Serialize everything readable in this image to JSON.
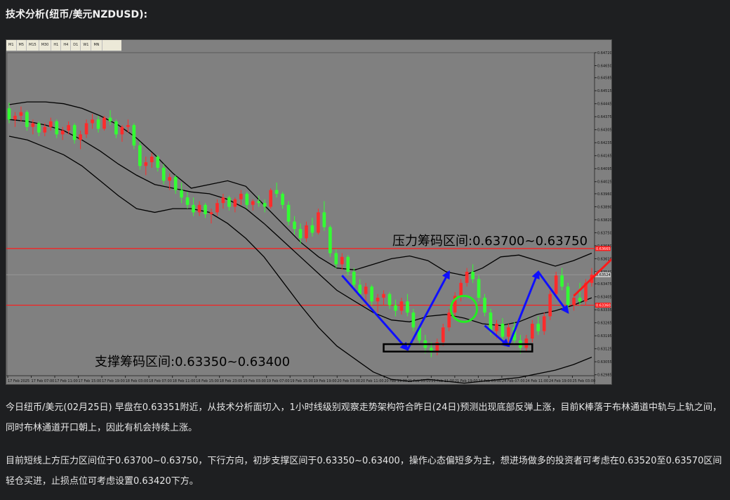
{
  "page": {
    "title": "技术分析(纽币/美元NZDUSD):",
    "paragraphs": [
      "今日纽币/美元(02月25日) 早盘在0.63351附近，从技术分析面切入，1小时线级别观察走势架构符合昨日(24日)预测出现底部反弹上涨，目前K棒落于布林通道中轨与上轨之间，同时布林通道开口朝上，因此有机会持续上涨。",
      "目前短线上方压力区间位于0.63700~0.63750，下行方向，初步支撑区间于0.63350~0.63400，操作心态偏短多为主，想进场做多的投资者可考虑在0.63520至0.63570区间轻仓买进，止损点位可考虑设置0.63420下方。"
    ]
  },
  "chart_data": {
    "type": "candlestick",
    "symbol": "NZDUSD",
    "timeframe": "H1",
    "timeframes": [
      "M1",
      "M5",
      "M15",
      "M30",
      "H1",
      "H4",
      "D1",
      "W1",
      "MN"
    ],
    "ylim": [
      0.6298,
      0.6472
    ],
    "y_ticks": [
      0.6472,
      0.6465,
      0.64585,
      0.64515,
      0.64445,
      0.64375,
      0.64305,
      0.64235,
      0.64165,
      0.64095,
      0.64025,
      0.6396,
      0.6389,
      0.6382,
      0.6375,
      0.6368,
      0.6361,
      0.6354,
      0.63475,
      0.63405,
      0.63335,
      0.63265,
      0.63195,
      0.63125,
      0.63055,
      0.62985
    ],
    "x_ticks": [
      "17 Feb 2025",
      "17 Feb 07:00",
      "17 Feb 11:00",
      "17 Feb 15:00",
      "17 Feb 19:00",
      "18 Feb 03:00",
      "18 Feb 07:00",
      "18 Feb 11:00",
      "18 Feb 15:00",
      "18 Feb 23:00",
      "19 Feb 03:00",
      "19 Feb 07:00",
      "19 Feb 15:00",
      "19 Feb 19:00",
      "20 Feb 03:00",
      "20 Feb 11:00",
      "20 Feb 19:00",
      "21 Feb 03:00",
      "21 Feb 11:00",
      "21 Feb 19:00",
      "24 Feb 03:00",
      "24 Feb 07:00",
      "24 Feb 11:00",
      "24 Feb 19:00",
      "25 Feb 03:00"
    ],
    "resistance_zone": {
      "label": "压力筹码区间:0.63700~0.63750",
      "low": 0.637,
      "high": 0.6375
    },
    "support_zone": {
      "label": "支撑筹码区间:0.63350~0.63400",
      "low": 0.6335,
      "high": 0.634
    },
    "horizontal_lines": [
      {
        "value": 0.63665,
        "label": "0.63665",
        "color": "#ff1a1a"
      },
      {
        "value": 0.6336,
        "label": "0.63360",
        "color": "#ff1a1a"
      }
    ],
    "current_price": {
      "value": 0.63524,
      "label": "0.63524"
    },
    "colors": {
      "background": "#808080",
      "bull": "#ff2b2b",
      "bear": "#33ff33",
      "bands": "#000000",
      "arrow": "#1010ff",
      "forecast_arrow": "#ff1a1a",
      "ellipse": "#22ee22",
      "support_box": "#000000"
    },
    "candles": [
      [
        0.6442,
        0.6445,
        0.6434,
        0.6436
      ],
      [
        0.6436,
        0.644,
        0.6432,
        0.6438
      ],
      [
        0.6438,
        0.6443,
        0.6435,
        0.644
      ],
      [
        0.644,
        0.6441,
        0.643,
        0.6432
      ],
      [
        0.6432,
        0.6436,
        0.6428,
        0.6434
      ],
      [
        0.6434,
        0.6435,
        0.6427,
        0.6429
      ],
      [
        0.6429,
        0.6434,
        0.6427,
        0.6432
      ],
      [
        0.6432,
        0.6437,
        0.643,
        0.6435
      ],
      [
        0.6435,
        0.6436,
        0.6426,
        0.6428
      ],
      [
        0.6428,
        0.6432,
        0.6425,
        0.643
      ],
      [
        0.643,
        0.6435,
        0.6428,
        0.6433
      ],
      [
        0.6433,
        0.6434,
        0.6423,
        0.6425
      ],
      [
        0.6425,
        0.643,
        0.642,
        0.6428
      ],
      [
        0.6428,
        0.6436,
        0.6426,
        0.6434
      ],
      [
        0.6434,
        0.6439,
        0.6431,
        0.6436
      ],
      [
        0.6436,
        0.6438,
        0.6429,
        0.6431
      ],
      [
        0.6431,
        0.6438,
        0.643,
        0.6437
      ],
      [
        0.6437,
        0.6441,
        0.6433,
        0.6435
      ],
      [
        0.6435,
        0.6436,
        0.6426,
        0.6428
      ],
      [
        0.6428,
        0.6433,
        0.6424,
        0.6432
      ],
      [
        0.6432,
        0.6436,
        0.6429,
        0.6433
      ],
      [
        0.6433,
        0.6434,
        0.642,
        0.6422
      ],
      [
        0.6422,
        0.6424,
        0.6409,
        0.6411
      ],
      [
        0.6411,
        0.6416,
        0.6406,
        0.6413
      ],
      [
        0.6413,
        0.6418,
        0.641,
        0.6416
      ],
      [
        0.6416,
        0.6417,
        0.6408,
        0.641
      ],
      [
        0.641,
        0.6412,
        0.6401,
        0.6403
      ],
      [
        0.6403,
        0.6407,
        0.6398,
        0.6405
      ],
      [
        0.6405,
        0.6406,
        0.6396,
        0.6398
      ],
      [
        0.6398,
        0.6402,
        0.6391,
        0.6394
      ],
      [
        0.6394,
        0.6397,
        0.6388,
        0.639
      ],
      [
        0.639,
        0.6394,
        0.6384,
        0.6386
      ],
      [
        0.6386,
        0.6392,
        0.6384,
        0.639
      ],
      [
        0.639,
        0.6391,
        0.6383,
        0.6385
      ],
      [
        0.6385,
        0.6388,
        0.638,
        0.6386
      ],
      [
        0.6386,
        0.6393,
        0.6384,
        0.6391
      ],
      [
        0.6391,
        0.6396,
        0.6388,
        0.6394
      ],
      [
        0.6394,
        0.6395,
        0.6387,
        0.6389
      ],
      [
        0.6389,
        0.6394,
        0.6386,
        0.6393
      ],
      [
        0.6393,
        0.6398,
        0.639,
        0.6396
      ],
      [
        0.6396,
        0.6397,
        0.6388,
        0.639
      ],
      [
        0.639,
        0.6393,
        0.6387,
        0.6392
      ],
      [
        0.6392,
        0.6395,
        0.6389,
        0.6391
      ],
      [
        0.6391,
        0.6393,
        0.6386,
        0.6389
      ],
      [
        0.6389,
        0.6399,
        0.6388,
        0.6398
      ],
      [
        0.6398,
        0.6402,
        0.6394,
        0.6396
      ],
      [
        0.6396,
        0.6397,
        0.6388,
        0.639
      ],
      [
        0.639,
        0.6392,
        0.6379,
        0.6381
      ],
      [
        0.6381,
        0.6384,
        0.6374,
        0.6377
      ],
      [
        0.6377,
        0.638,
        0.6369,
        0.6372
      ],
      [
        0.6372,
        0.6381,
        0.637,
        0.6379
      ],
      [
        0.6379,
        0.6383,
        0.6373,
        0.6375
      ],
      [
        0.6375,
        0.6388,
        0.6374,
        0.6386
      ],
      [
        0.6386,
        0.6392,
        0.6376,
        0.6378
      ],
      [
        0.6378,
        0.6379,
        0.6362,
        0.6364
      ],
      [
        0.6364,
        0.6366,
        0.6356,
        0.6358
      ],
      [
        0.6358,
        0.6364,
        0.6355,
        0.6362
      ],
      [
        0.6362,
        0.6363,
        0.6352,
        0.6354
      ],
      [
        0.6354,
        0.6356,
        0.6345,
        0.6347
      ],
      [
        0.6347,
        0.635,
        0.634,
        0.6342
      ],
      [
        0.6342,
        0.6348,
        0.6338,
        0.6346
      ],
      [
        0.6346,
        0.6347,
        0.6336,
        0.6338
      ],
      [
        0.6338,
        0.6342,
        0.6332,
        0.634
      ],
      [
        0.634,
        0.6344,
        0.6336,
        0.6342
      ],
      [
        0.6342,
        0.6343,
        0.6334,
        0.6336
      ],
      [
        0.6336,
        0.6339,
        0.633,
        0.6333
      ],
      [
        0.6333,
        0.634,
        0.6331,
        0.6338
      ],
      [
        0.6338,
        0.6342,
        0.633,
        0.6332
      ],
      [
        0.6332,
        0.6334,
        0.6322,
        0.6324
      ],
      [
        0.6324,
        0.6325,
        0.6315,
        0.6317
      ],
      [
        0.6317,
        0.632,
        0.631,
        0.6313
      ],
      [
        0.6313,
        0.6316,
        0.6308,
        0.6311
      ],
      [
        0.6311,
        0.6318,
        0.6309,
        0.6316
      ],
      [
        0.6316,
        0.6326,
        0.6314,
        0.6324
      ],
      [
        0.6324,
        0.6334,
        0.6322,
        0.6332
      ],
      [
        0.6332,
        0.6343,
        0.633,
        0.6341
      ],
      [
        0.6341,
        0.635,
        0.6338,
        0.6348
      ],
      [
        0.6348,
        0.6356,
        0.6346,
        0.6354
      ],
      [
        0.6354,
        0.6358,
        0.6348,
        0.635
      ],
      [
        0.635,
        0.6352,
        0.6338,
        0.634
      ],
      [
        0.634,
        0.6342,
        0.633,
        0.6332
      ],
      [
        0.6332,
        0.6334,
        0.632,
        0.6322
      ],
      [
        0.6322,
        0.6328,
        0.6318,
        0.6326
      ],
      [
        0.6326,
        0.6329,
        0.6317,
        0.6319
      ],
      [
        0.6319,
        0.6326,
        0.6316,
        0.6324
      ],
      [
        0.6324,
        0.6327,
        0.6315,
        0.6317
      ],
      [
        0.6317,
        0.632,
        0.631,
        0.6313
      ],
      [
        0.6313,
        0.632,
        0.6311,
        0.6318
      ],
      [
        0.6318,
        0.6328,
        0.6316,
        0.6326
      ],
      [
        0.6326,
        0.633,
        0.632,
        0.6322
      ],
      [
        0.6322,
        0.6332,
        0.632,
        0.633
      ],
      [
        0.633,
        0.6344,
        0.6328,
        0.6342
      ],
      [
        0.6342,
        0.6354,
        0.634,
        0.6352
      ],
      [
        0.6352,
        0.6356,
        0.6344,
        0.6346
      ],
      [
        0.6346,
        0.6348,
        0.6334,
        0.6336
      ],
      [
        0.6336,
        0.6342,
        0.6333,
        0.634
      ],
      [
        0.634,
        0.6348,
        0.6336,
        0.6338
      ],
      [
        0.6338,
        0.635,
        0.6336,
        0.6348
      ],
      [
        0.6348,
        0.6356,
        0.6346,
        0.63524
      ]
    ],
    "bands": {
      "upper": [
        0.6444,
        0.64455,
        0.64455,
        0.64445,
        0.6442,
        0.6438,
        0.6433,
        0.6426,
        0.6417,
        0.6407,
        0.6399,
        0.6401,
        0.6403,
        0.64,
        0.639,
        0.638,
        0.637,
        0.6362,
        0.6356,
        0.6355,
        0.6358,
        0.6361,
        0.63625,
        0.636,
        0.6354,
        0.6352,
        0.6356,
        0.6362,
        0.6363,
        0.636,
        0.6357,
        0.636,
        0.6364
      ],
      "middle": [
        0.6436,
        0.6435,
        0.6433,
        0.643,
        0.6425,
        0.6419,
        0.6412,
        0.6406,
        0.6401,
        0.6399,
        0.6397,
        0.6396,
        0.6393,
        0.6388,
        0.638,
        0.6371,
        0.6362,
        0.6353,
        0.6344,
        0.6338,
        0.6332,
        0.6328,
        0.6327,
        0.633,
        0.6331,
        0.6329,
        0.6326,
        0.6325,
        0.6327,
        0.6331,
        0.6333,
        0.6336,
        0.634
      ],
      "lower": [
        0.6427,
        0.6425,
        0.6421,
        0.6417,
        0.6411,
        0.6403,
        0.6395,
        0.6388,
        0.6386,
        0.6388,
        0.6388,
        0.6386,
        0.638,
        0.6372,
        0.6362,
        0.6349,
        0.6336,
        0.6324,
        0.6314,
        0.6307,
        0.63,
        0.6296,
        0.6295,
        0.6296,
        0.6295,
        0.6294,
        0.6295,
        0.6296,
        0.6297,
        0.6299,
        0.6301,
        0.6304,
        0.6308
      ]
    },
    "forecast_arrows": [
      {
        "from": [
          56,
          0.6352
        ],
        "to": [
          67,
          0.6312
        ]
      },
      {
        "from": [
          67,
          0.6312
        ],
        "to": [
          74,
          0.6354
        ]
      },
      {
        "from": [
          80,
          0.6325
        ],
        "to": [
          84,
          0.6314
        ]
      },
      {
        "from": [
          84,
          0.6314
        ],
        "to": [
          89,
          0.6354
        ]
      },
      {
        "from": [
          89,
          0.6354
        ],
        "to": [
          94,
          0.6332
        ]
      }
    ],
    "forecast_up": {
      "from": [
        95,
        0.6341
      ],
      "to": [
        104,
        0.6369
      ]
    },
    "ellipse": {
      "cx": 76.5,
      "cy": 0.6334,
      "rx": 2.2,
      "ry": 0.0007
    },
    "support_box": {
      "from": [
        63,
        0.6311
      ],
      "to": [
        88,
        0.6315
      ]
    }
  }
}
